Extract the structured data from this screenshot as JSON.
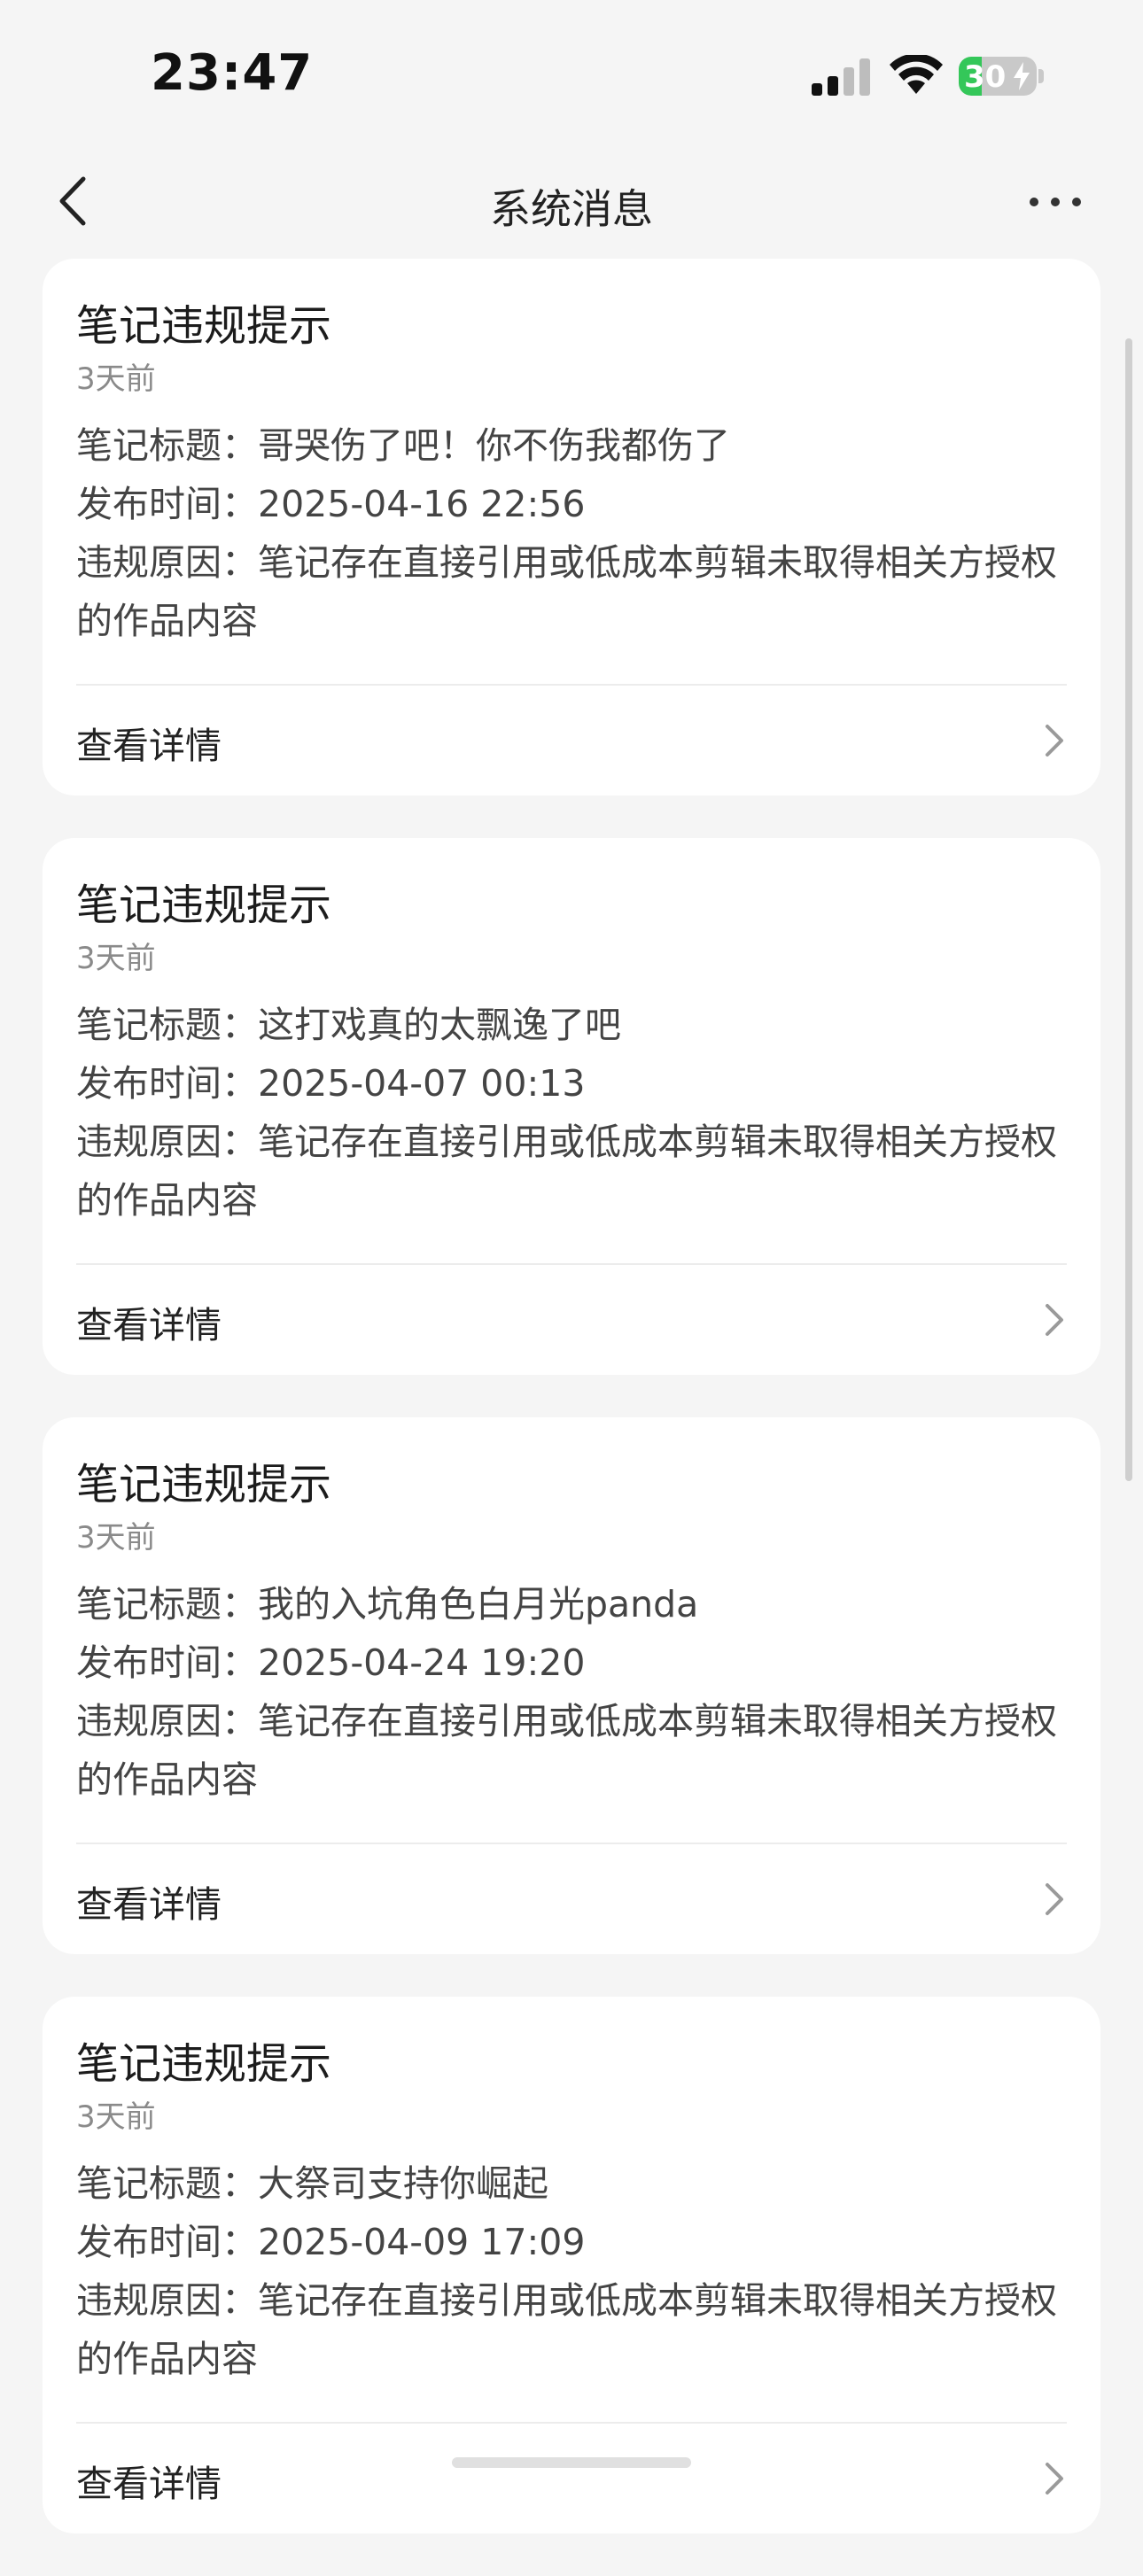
{
  "status_bar": {
    "time": "23:47",
    "battery_level": 30,
    "battery_text": "30",
    "signal_bars_active": 2,
    "signal_bars_total": 4
  },
  "nav": {
    "title": "系统消息",
    "back_icon": "chevron-left-icon",
    "more_icon": "more-horizontal-icon"
  },
  "messages": [
    {
      "title": "笔记违规提示",
      "time": "3天前",
      "note_title_label": "笔记标题：",
      "note_title": "哥哭伤了吧！你不伤我都伤了",
      "publish_label": "发布时间：",
      "publish_time": "2025-04-16 22:56",
      "reason_label": "违规原因：",
      "reason": "笔记存在直接引用或低成本剪辑未取得相关方授权的作品内容",
      "detail_label": "查看详情"
    },
    {
      "title": "笔记违规提示",
      "time": "3天前",
      "note_title_label": "笔记标题：",
      "note_title": "这打戏真的太飘逸了吧",
      "publish_label": "发布时间：",
      "publish_time": "2025-04-07 00:13",
      "reason_label": "违规原因：",
      "reason": "笔记存在直接引用或低成本剪辑未取得相关方授权的作品内容",
      "detail_label": "查看详情"
    },
    {
      "title": "笔记违规提示",
      "time": "3天前",
      "note_title_label": "笔记标题：",
      "note_title": "我的入坑角色白月光panda",
      "publish_label": "发布时间：",
      "publish_time": "2025-04-24 19:20",
      "reason_label": "违规原因：",
      "reason": "笔记存在直接引用或低成本剪辑未取得相关方授权的作品内容",
      "detail_label": "查看详情"
    },
    {
      "title": "笔记违规提示",
      "time": "3天前",
      "note_title_label": "笔记标题：",
      "note_title": "大祭司支持你崛起",
      "publish_label": "发布时间：",
      "publish_time": "2025-04-09 17:09",
      "reason_label": "违规原因：",
      "reason": "笔记存在直接引用或低成本剪辑未取得相关方授权的作品内容",
      "detail_label": "查看详情"
    }
  ],
  "colors": {
    "background": "#f5f5f5",
    "card": "#ffffff",
    "battery_green": "#34c759",
    "muted_text": "#8a8a8a"
  }
}
